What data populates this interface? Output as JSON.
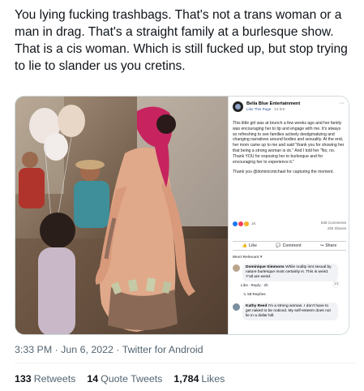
{
  "tweet": {
    "text": "You lying fucking trashbags. That's not a trans woman or a man in drag.  That's a straight family at a burlesque show. That is a cis woman. Which is still fucked up, but stop trying to lie to slander us you cretins.",
    "timestamp": "3:33 PM · Jun 6, 2022 · Twitter for Android",
    "retweets_count": "133",
    "retweets_label": "Retweets",
    "quote_tweets_count": "14",
    "quote_tweets_label": "Quote Tweets",
    "likes_count": "1,784",
    "likes_label": "Likes"
  },
  "facebook_post": {
    "page_name": "Bella Blue Entertainment",
    "like_page_label": "Like This Page",
    "time": "21 hrs",
    "paragraphs": [
      "This little girl was at brunch a few weeks ago and her family was encouraging her to tip and engage with me. It's always so refreshing to see families actively destigmatizing and changing narratives around bodies and sexuality. At the end, her mom came up to me and said \"thank you for showing her that being a strong woman is ok.\" And I told her \"No, no. Thank YOU for exposing her to burlesque and for encouraging her to experience it.\"",
      "Thank you @dominicmichael for capturing the moment."
    ],
    "reactions_count": "1K",
    "comments_count": "638 Comments",
    "shares_count": "436 Shares",
    "actions": {
      "like": "Like",
      "comment": "Comment",
      "share": "Share"
    },
    "sort_label": "Most Relevant",
    "comments": [
      {
        "name": "Dominique Simmons",
        "text": "While nudity isnt sexual by nature burlesque most certainly is. This is weird. Y'all are weird.",
        "actions": "Like · Reply · 2h",
        "reaction_count": "14",
        "replies": "58 Replies"
      },
      {
        "name": "Kathy Reed",
        "text": "I'm a strong woman. I don't have to get naked to be noticed. My self-esteem does not lie in a dollar bill."
      }
    ]
  },
  "colors": {
    "text_primary": "#0f1419",
    "text_secondary": "#536471",
    "facebook_blue": "#1877f2",
    "hair_pink": "#d02a6a"
  },
  "icons": [
    "verified-page-icon",
    "more-options-icon",
    "like-icon",
    "comment-icon",
    "share-icon"
  ]
}
